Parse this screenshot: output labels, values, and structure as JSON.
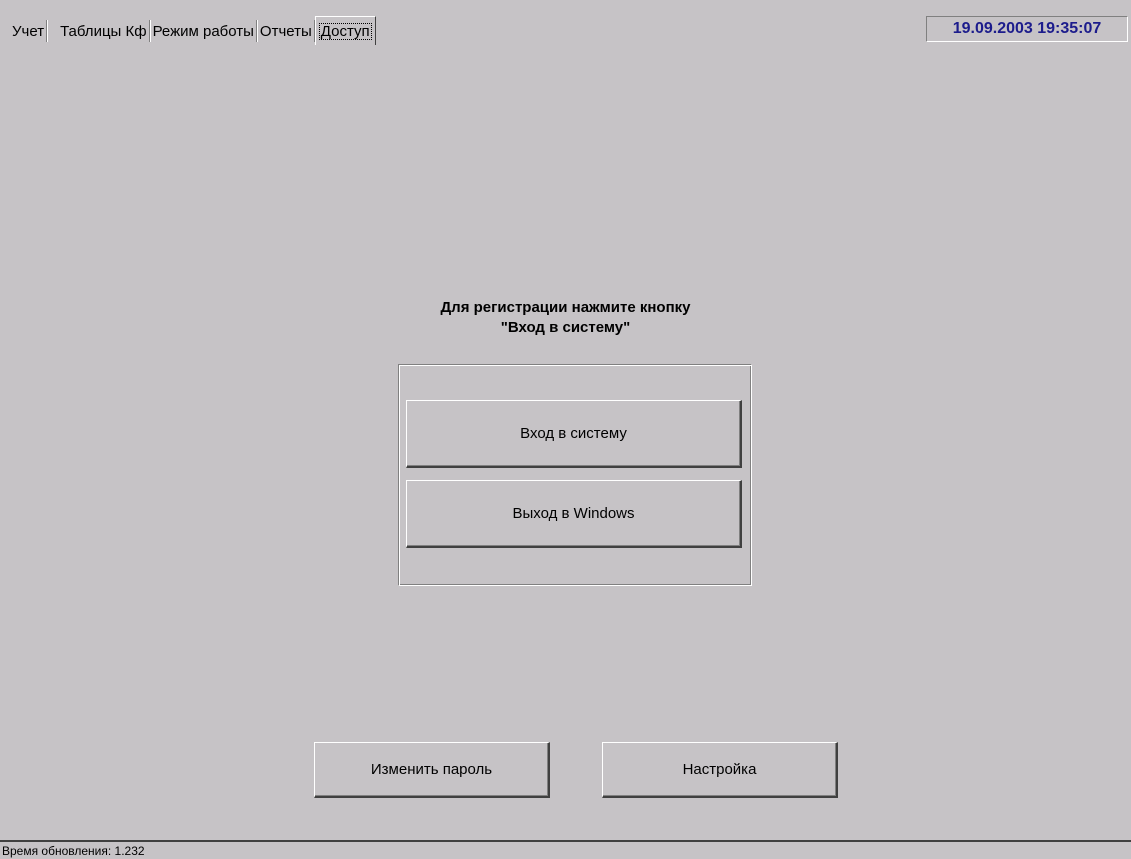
{
  "tabs": [
    {
      "label": "Учет",
      "active": false
    },
    {
      "label": "Таблицы Кф",
      "active": false
    },
    {
      "label": "Режим работы",
      "active": false
    },
    {
      "label": "Отчеты",
      "active": false
    },
    {
      "label": "Доступ",
      "active": true
    }
  ],
  "datetime": "19.09.2003 19:35:07",
  "main": {
    "instruction_line1": "Для регистрации нажмите кнопку",
    "instruction_line2": "\"Вход в систему\"",
    "login_button": "Вход в систему",
    "exit_button": "Выход в Windows",
    "change_password_button": "Изменить пароль",
    "settings_button": "Настройка"
  },
  "statusbar": {
    "text": "Время обновления: 1.232"
  },
  "colors": {
    "background": "#c6c3c6",
    "datetime_text": "#1c1c8c"
  }
}
